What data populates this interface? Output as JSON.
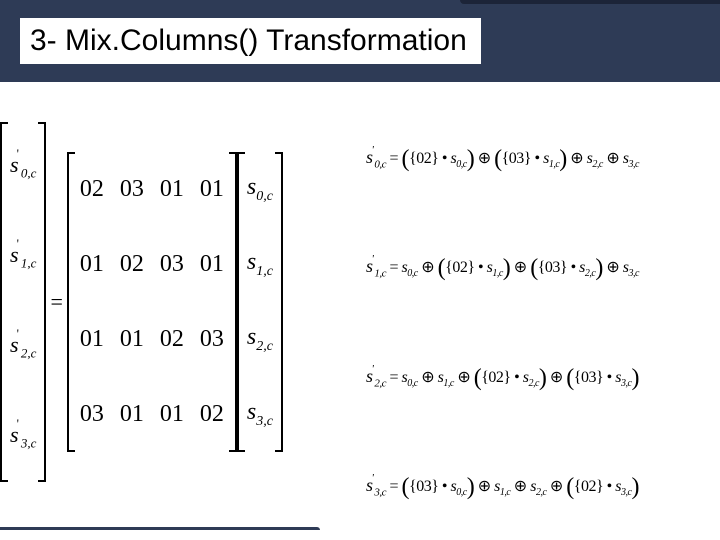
{
  "title": "3- Mix.Columns() Transformation",
  "result_vector": [
    "s′0,c",
    "s′1,c",
    "s′2,c",
    "s′3,c"
  ],
  "coef_matrix": [
    [
      "02",
      "03",
      "01",
      "01"
    ],
    [
      "01",
      "02",
      "03",
      "01"
    ],
    [
      "01",
      "01",
      "02",
      "03"
    ],
    [
      "03",
      "01",
      "01",
      "02"
    ]
  ],
  "state_vector": [
    "s0,c",
    "s1,c",
    "s2,c",
    "s3,c"
  ],
  "equations": {
    "e0": {
      "lhs": "s′0,c",
      "rhs": "= ({02} • s0,c) ⊕ ({03} • s1,c) ⊕ s2,c ⊕ s3,c"
    },
    "e1": {
      "lhs": "s′1,c",
      "rhs": "= s0,c ⊕ ({02} • s1,c) ⊕ ({03} • s2,c) ⊕ s3,c"
    },
    "e2": {
      "lhs": "s′2,c",
      "rhs": "= s0,c ⊕ s1,c ⊕ ({02} • s2,c) ⊕ ({03} • s3,c)"
    },
    "e3": {
      "lhs": "s′3,c",
      "rhs": "= ({03} • s0,c) ⊕ s1,c ⊕ s2,c ⊕ ({02} • s3,c)"
    }
  }
}
